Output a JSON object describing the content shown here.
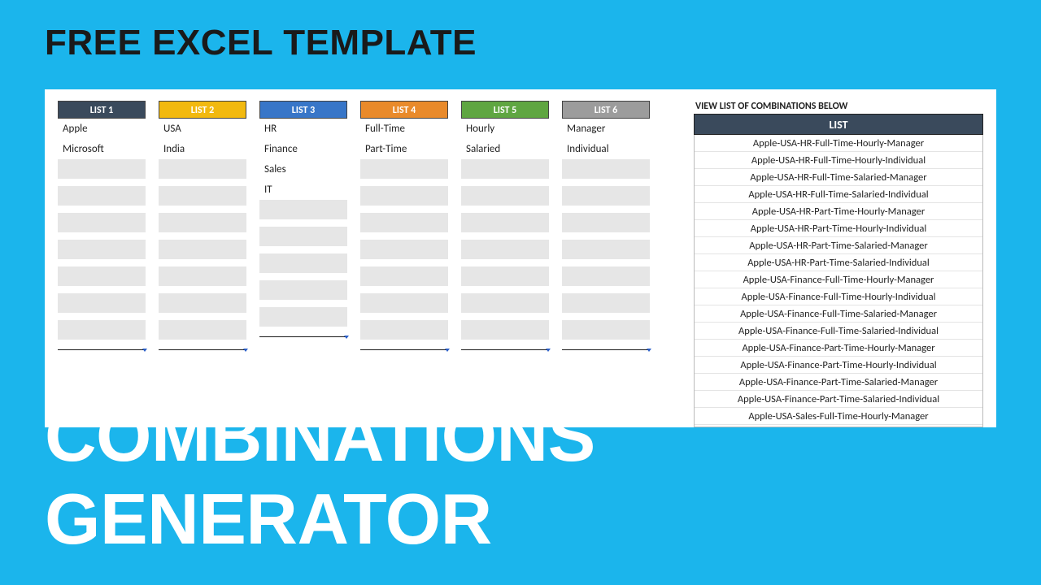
{
  "topTitle": "FREE EXCEL TEMPLATE",
  "bottomTitle": "COMBINATIONS GENERATOR",
  "lists": [
    {
      "header": "LIST 1",
      "colorClass": "h1c",
      "items": [
        "Apple",
        "Microsoft"
      ]
    },
    {
      "header": "LIST 2",
      "colorClass": "h2c",
      "items": [
        "USA",
        "India"
      ]
    },
    {
      "header": "LIST 3",
      "colorClass": "h3c",
      "items": [
        "HR",
        "Finance",
        "Sales",
        "IT"
      ]
    },
    {
      "header": "LIST 4",
      "colorClass": "h4c",
      "items": [
        "Full-Time",
        "Part-Time"
      ]
    },
    {
      "header": "LIST 5",
      "colorClass": "h5c",
      "items": [
        "Hourly",
        "Salaried"
      ]
    },
    {
      "header": "LIST 6",
      "colorClass": "h6c",
      "items": [
        "Manager",
        "Individual"
      ]
    }
  ],
  "rowsPerList": 9,
  "resultsCaption": "VIEW LIST OF COMBINATIONS BELOW",
  "resultsHeader": "LIST",
  "results": [
    "Apple-USA-HR-Full-Time-Hourly-Manager",
    "Apple-USA-HR-Full-Time-Hourly-Individual",
    "Apple-USA-HR-Full-Time-Salaried-Manager",
    "Apple-USA-HR-Full-Time-Salaried-Individual",
    "Apple-USA-HR-Part-Time-Hourly-Manager",
    "Apple-USA-HR-Part-Time-Hourly-Individual",
    "Apple-USA-HR-Part-Time-Salaried-Manager",
    "Apple-USA-HR-Part-Time-Salaried-Individual",
    "Apple-USA-Finance-Full-Time-Hourly-Manager",
    "Apple-USA-Finance-Full-Time-Hourly-Individual",
    "Apple-USA-Finance-Full-Time-Salaried-Manager",
    "Apple-USA-Finance-Full-Time-Salaried-Individual",
    "Apple-USA-Finance-Part-Time-Hourly-Manager",
    "Apple-USA-Finance-Part-Time-Hourly-Individual",
    "Apple-USA-Finance-Part-Time-Salaried-Manager",
    "Apple-USA-Finance-Part-Time-Salaried-Individual",
    "Apple-USA-Sales-Full-Time-Hourly-Manager"
  ]
}
